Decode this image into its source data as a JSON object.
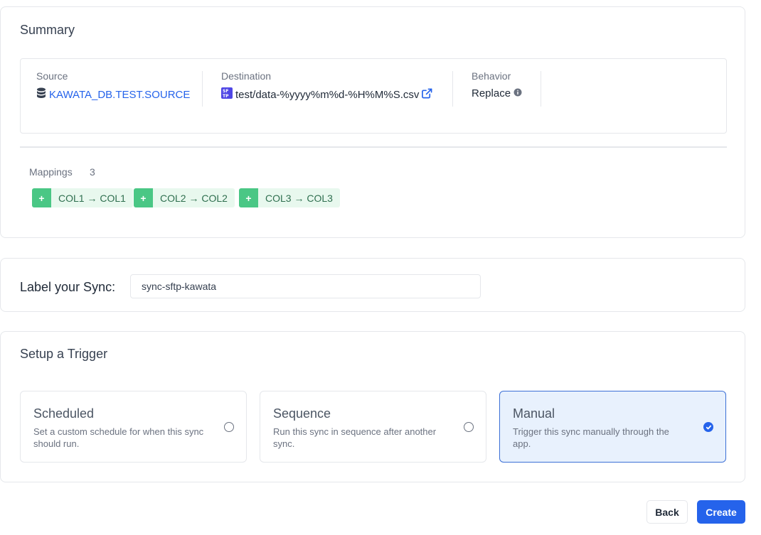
{
  "summary": {
    "title": "Summary",
    "source": {
      "label": "Source",
      "value": "KAWATA_DB.TEST.SOURCE",
      "icon": "database-icon"
    },
    "destination": {
      "label": "Destination",
      "value": "test/data-%yyyy%m%d-%H%M%S.csv",
      "icon": "sftp-icon",
      "link_icon": "external-link-icon"
    },
    "behavior": {
      "label": "Behavior",
      "value": "Replace",
      "icon": "info-icon"
    }
  },
  "mappings": {
    "label": "Mappings",
    "count": "3",
    "items": [
      {
        "text": "COL1 → COL1"
      },
      {
        "text": "COL2 → COL2"
      },
      {
        "text": "COL3 → COL3"
      }
    ],
    "plus": "+"
  },
  "label_sync": {
    "label": "Label your Sync:",
    "value": "sync-sftp-kawata"
  },
  "trigger": {
    "title": "Setup a Trigger",
    "options": [
      {
        "title": "Scheduled",
        "description": "Set a custom schedule for when this sync should run.",
        "selected": false
      },
      {
        "title": "Sequence",
        "description": "Run this sync in sequence after another sync.",
        "selected": false
      },
      {
        "title": "Manual",
        "description": "Trigger this sync manually through the app.",
        "selected": true
      }
    ]
  },
  "buttons": {
    "back": "Back",
    "create": "Create"
  },
  "colors": {
    "accent": "#2563eb",
    "mapping_plus": "#4ac785",
    "mapping_bg": "#e8f8ee",
    "selected_bg": "#e8f1fd"
  }
}
